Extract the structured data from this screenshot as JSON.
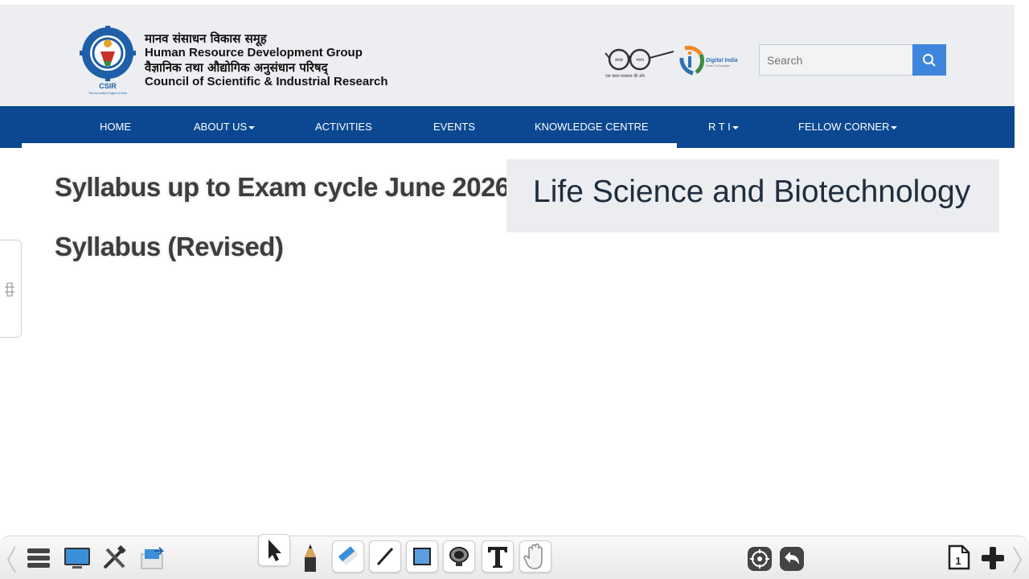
{
  "header": {
    "org_hindi_1": "मानव संसाधन विकास समूह",
    "org_english_1": "Human Resource Development Group",
    "org_hindi_2": "वैज्ञानिक तथा औद्योगिक अनुसंधान परिषद्",
    "org_english_2": "Council of Scientific & Industrial Research",
    "logo_text": "CSIR",
    "logo_tagline": "The Innovation Engine of India",
    "swachh_words": [
      "स्वच्छ",
      "भारत"
    ],
    "swachh_tagline": "एक कदम स्वच्छता की ओर",
    "digital_title": "Digital India",
    "digital_tagline": "Power To Empower",
    "search": {
      "placeholder": "Search",
      "value": ""
    }
  },
  "nav": {
    "items": [
      {
        "label": "HOME",
        "dropdown": false
      },
      {
        "label": "ABOUT US",
        "dropdown": true
      },
      {
        "label": "ACTIVITIES",
        "dropdown": false
      },
      {
        "label": "EVENTS",
        "dropdown": false
      },
      {
        "label": "KNOWLEDGE CENTRE",
        "dropdown": false
      },
      {
        "label": "R T I",
        "dropdown": true
      },
      {
        "label": "FELLOW CORNER",
        "dropdown": true
      }
    ]
  },
  "main": {
    "heading1": "Syllabus up to Exam cycle June 2026",
    "heading2": "Syllabus (Revised)",
    "panel_title": "Life Science and Biotechnology"
  },
  "toolbar": {
    "page_number": "1",
    "icons": [
      "menu-icon",
      "desktop-icon",
      "tools-icon",
      "switch-icon",
      "pointer-icon",
      "pencil-icon",
      "eraser-icon",
      "line-icon",
      "rectangle-icon",
      "spotlight-icon",
      "text-icon",
      "hand-icon",
      "target-icon",
      "undo-icon",
      "page-icon",
      "add-icon"
    ]
  },
  "colors": {
    "nav_bg": "#0b4891",
    "header_bg": "#eceef2",
    "search_button": "#3e86dd",
    "panel_bg": "#ebedf0"
  }
}
